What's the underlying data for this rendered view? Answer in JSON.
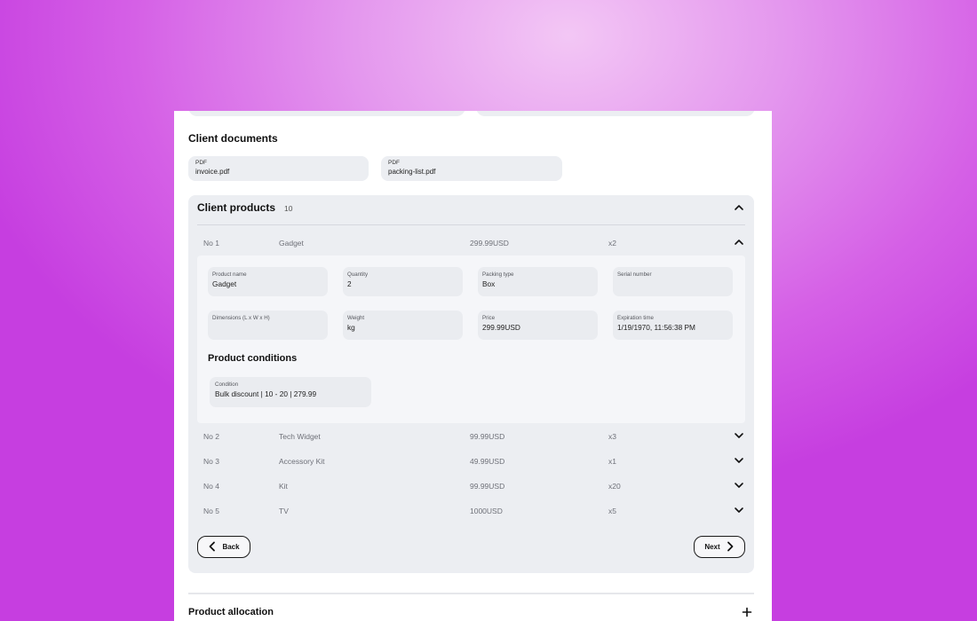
{
  "documents": {
    "title": "Client documents",
    "items": [
      {
        "type": "PDF",
        "name": "invoice.pdf"
      },
      {
        "type": "PDF",
        "name": "packing-list.pdf"
      }
    ]
  },
  "products": {
    "title": "Client products",
    "count": "10",
    "rows": [
      {
        "no": "No 1",
        "name": "Gadget",
        "price": "299.99USD",
        "qty": "x2",
        "expanded": true
      },
      {
        "no": "No 2",
        "name": "Tech Widget",
        "price": "99.99USD",
        "qty": "x3"
      },
      {
        "no": "No 3",
        "name": "Accessory Kit",
        "price": "49.99USD",
        "qty": "x1"
      },
      {
        "no": "No 4",
        "name": "Kit",
        "price": "99.99USD",
        "qty": "x20"
      },
      {
        "no": "No 5",
        "name": "TV",
        "price": "1000USD",
        "qty": "x5"
      }
    ],
    "detail": {
      "fields": [
        {
          "label": "Product name",
          "value": "Gadget"
        },
        {
          "label": "Quantity",
          "value": "2"
        },
        {
          "label": "Packing type",
          "value": "Box"
        },
        {
          "label": "Serial number",
          "value": ""
        },
        {
          "label": "Dimensions (L x W x H)",
          "value": ""
        },
        {
          "label": "Weight",
          "value": "kg"
        },
        {
          "label": "Price",
          "value": "299.99USD"
        },
        {
          "label": "Expiration time",
          "value": "1/19/1970, 11:56:38 PM"
        }
      ],
      "conditions_title": "Product conditions",
      "condition": {
        "label": "Condition",
        "value": "Bulk discount | 10 - 20 | 279.99"
      }
    },
    "back_label": "Back",
    "next_label": "Next"
  },
  "allocation": {
    "title": "Product allocation"
  },
  "icons": {
    "collapse": "chevron-up-icon",
    "expand": "chevron-down-icon",
    "back": "chevron-left-icon",
    "next": "chevron-right-icon",
    "add": "plus-icon"
  }
}
